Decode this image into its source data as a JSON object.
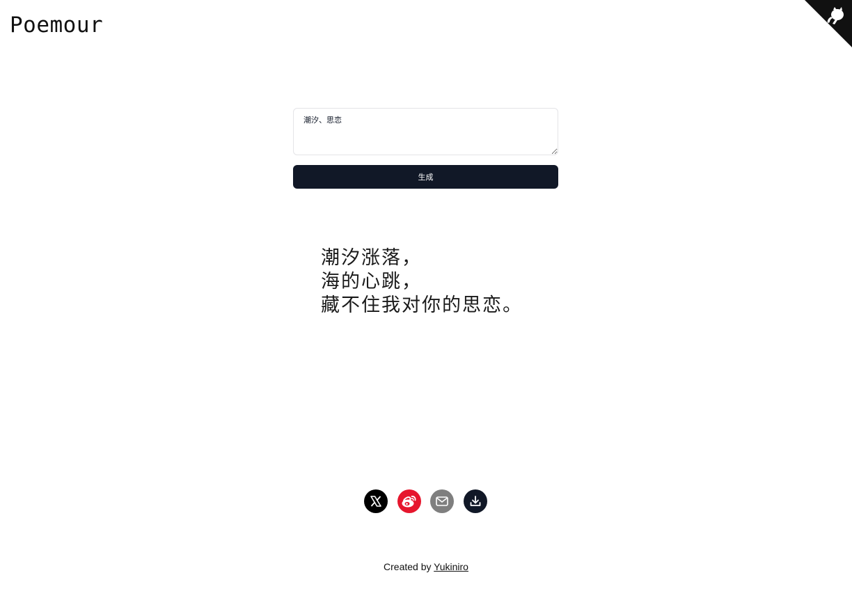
{
  "header": {
    "title": "Poemour"
  },
  "prompt": {
    "value": "潮汐、思恋"
  },
  "generate": {
    "label": "生成"
  },
  "poem": {
    "lines": [
      "潮汐涨落，",
      "海的心跳，",
      "藏不住我对你的思恋。"
    ]
  },
  "share": {
    "icons": [
      "x-icon",
      "weibo-icon",
      "email-icon",
      "download-icon"
    ],
    "colors": {
      "x": "#000000",
      "weibo": "#e6162d",
      "email": "#7f7f7f",
      "download": "#111827"
    }
  },
  "footer": {
    "prefix": "Created by",
    "author": "Yukiniro"
  },
  "corner": {
    "icon": "github-octocat-icon"
  }
}
